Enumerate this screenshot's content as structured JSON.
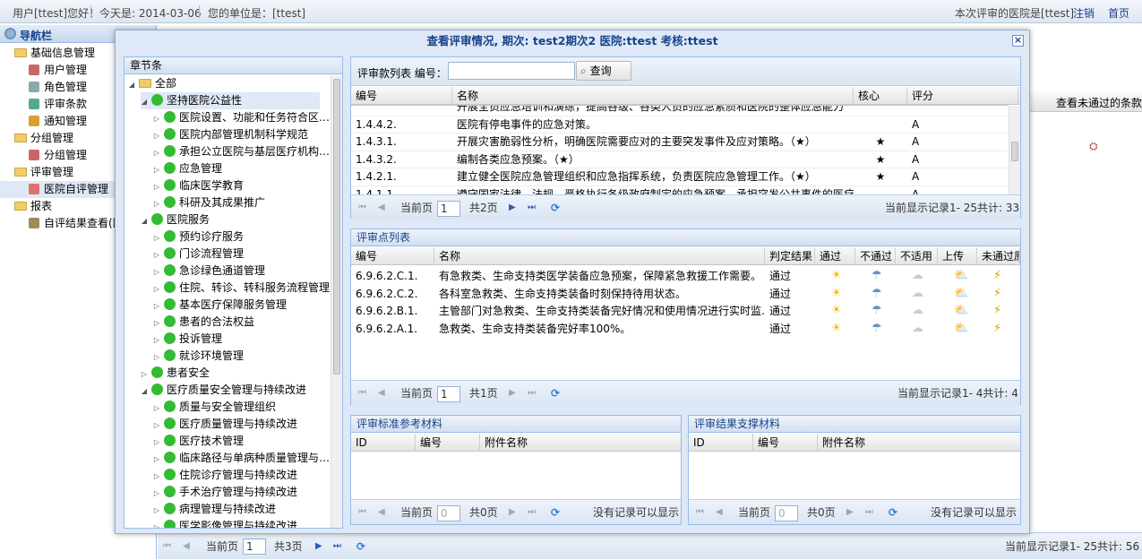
{
  "topbar": {
    "user": "用户[ttest]您好！",
    "today": "今天是:  2014-03-06",
    "unit": "您的单位是：[ttest]",
    "hospital": "本次评审的医院是[ttest]",
    "logout": "注销",
    "home": "首页"
  },
  "nav": {
    "title": "导航栏",
    "items": [
      {
        "label": "基础信息管理",
        "level": 0
      },
      {
        "label": "用户管理",
        "level": 1
      },
      {
        "label": "角色管理",
        "level": 1
      },
      {
        "label": "评审条款",
        "level": 1
      },
      {
        "label": "通知管理",
        "level": 1
      },
      {
        "label": "分组管理",
        "level": 0
      },
      {
        "label": "分组管理",
        "level": 1
      },
      {
        "label": "评审管理",
        "level": 0
      },
      {
        "label": "医院自评管理",
        "level": 1
      },
      {
        "label": "报表",
        "level": 0
      },
      {
        "label": "自评结果查看(医",
        "level": 1
      }
    ]
  },
  "background": {
    "col_header": "查看未通过的条款",
    "pager_current": "当前页",
    "pager_page": "1",
    "pager_total": "共3页",
    "pager_info": "当前显示记录1- 25共计: 56"
  },
  "dialog": {
    "title": "查看评审情况,   期次: test2期次2    医院:ttest    考核:ttest",
    "close": "×",
    "tree": {
      "header": "章节条",
      "nodes": [
        {
          "label": "全部",
          "level": 0,
          "expanded": true,
          "folder": true
        },
        {
          "label": "坚持医院公益性",
          "level": 1,
          "expanded": true
        },
        {
          "label": "医院设置、功能和任务符合区…",
          "level": 2
        },
        {
          "label": "医院内部管理机制科学规范",
          "level": 2
        },
        {
          "label": "承担公立医院与基层医疗机构…",
          "level": 2
        },
        {
          "label": "应急管理",
          "level": 2
        },
        {
          "label": "临床医学教育",
          "level": 2
        },
        {
          "label": "科研及其成果推广",
          "level": 2
        },
        {
          "label": "医院服务",
          "level": 1,
          "expanded": true
        },
        {
          "label": "预约诊疗服务",
          "level": 2
        },
        {
          "label": "门诊流程管理",
          "level": 2
        },
        {
          "label": "急诊绿色通道管理",
          "level": 2
        },
        {
          "label": "住院、转诊、转科服务流程管理",
          "level": 2
        },
        {
          "label": "基本医疗保障服务管理",
          "level": 2
        },
        {
          "label": "患者的合法权益",
          "level": 2
        },
        {
          "label": "投诉管理",
          "level": 2
        },
        {
          "label": "就诊环境管理",
          "level": 2
        },
        {
          "label": "患者安全",
          "level": 1,
          "expanded": false
        },
        {
          "label": "医疗质量安全管理与持续改进",
          "level": 1,
          "expanded": true
        },
        {
          "label": "质量与安全管理组织",
          "level": 2
        },
        {
          "label": "医疗质量管理与持续改进",
          "level": 2
        },
        {
          "label": "医疗技术管理",
          "level": 2
        },
        {
          "label": "临床路径与单病种质量管理与…",
          "level": 2
        },
        {
          "label": "住院诊疗管理与持续改进",
          "level": 2
        },
        {
          "label": "手术治疗管理与持续改进",
          "level": 2
        },
        {
          "label": "病理管理与持续改进",
          "level": 2
        },
        {
          "label": "医学影像管理与持续改进",
          "level": 2
        }
      ]
    },
    "clauses": {
      "search_label": "评审款列表 编号：",
      "search_value": "",
      "search_button": "查询",
      "columns": [
        "编号",
        "名称",
        "核心",
        "评分"
      ],
      "rows": [
        {
          "code": "",
          "name": "开展全员应急培训和演练，提高各级、各类人员的应急素质和医院的整体应急能力",
          "core": "",
          "score": ""
        },
        {
          "code": "1.4.4.2.",
          "name": "医院有停电事件的应急对策。",
          "core": "",
          "score": "A"
        },
        {
          "code": "1.4.3.1.",
          "name": "开展灾害脆弱性分析，明确医院需要应对的主要突发事件及应对策略。（★）",
          "core": "★",
          "score": "A"
        },
        {
          "code": "1.4.3.2.",
          "name": "编制各类应急预案。（★）",
          "core": "★",
          "score": "A"
        },
        {
          "code": "1.4.2.1.",
          "name": "建立健全医院应急管理组织和应急指挥系统，负责医院应急管理工作。（★）",
          "core": "★",
          "score": "A"
        },
        {
          "code": "1.4.1.1.",
          "name": "遵守国家法律、法规，严格执行各级政府制定的应急预案。承担突发公共事件的医疗救",
          "core": "",
          "score": "A"
        }
      ],
      "pager": {
        "current": "当前页",
        "page": "1",
        "total": "共2页",
        "info": "当前显示记录1- 25共计: 33"
      }
    },
    "points": {
      "header": "评审点列表",
      "columns": [
        "编号",
        "名称",
        "判定结果",
        "通过",
        "不通过",
        "不适用",
        "上传",
        "未通过原"
      ],
      "rows": [
        {
          "code": "6.9.6.2.C.1.",
          "name": "有急救类、生命支持类医学装备应急预案，保障紧急救援工作需要。",
          "result": "通过"
        },
        {
          "code": "6.9.6.2.C.2.",
          "name": "各科室急救类、生命支持类装备时刻保持待用状态。",
          "result": "通过"
        },
        {
          "code": "6.9.6.2.B.1.",
          "name": "主管部门对急救类、生命支持类装备完好情况和使用情况进行实时监…",
          "result": "通过"
        },
        {
          "code": "6.9.6.2.A.1.",
          "name": "急救类、生命支持类装备完好率100%。",
          "result": "通过"
        }
      ],
      "pager": {
        "current": "当前页",
        "page": "1",
        "total": "共1页",
        "info": "当前显示记录1- 4共计: 4"
      }
    },
    "refmat": {
      "header": "评审标准参考材料",
      "columns": [
        "ID",
        "编号",
        "附件名称"
      ],
      "pager": {
        "current": "当前页",
        "page": "0",
        "total": "共0页",
        "info": "没有记录可以显示"
      }
    },
    "supmat": {
      "header": "评审结果支撑材料",
      "columns": [
        "ID",
        "编号",
        "附件名称"
      ],
      "pager": {
        "current": "当前页",
        "page": "0",
        "total": "共0页",
        "info": "没有记录可以显示"
      }
    }
  }
}
